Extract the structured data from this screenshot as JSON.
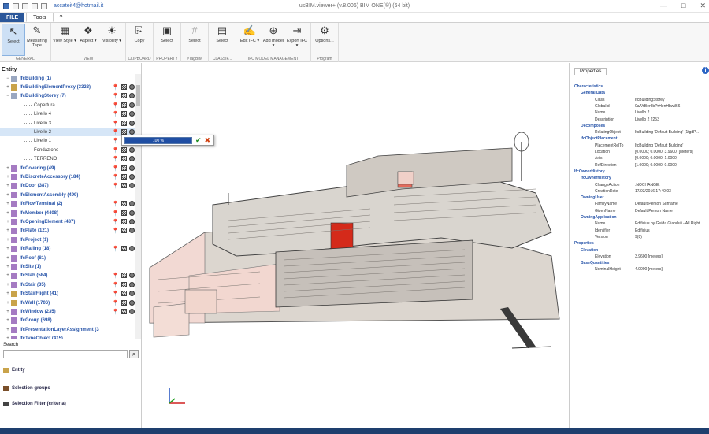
{
  "window": {
    "user": "accateit4@hotmail.it",
    "title": "usBIM.viewer+ (v.8.006) BIM ONE(®) (64 bit)",
    "controls": [
      "—",
      "□",
      "✕"
    ]
  },
  "tabs": [
    "FILE",
    "Tools",
    "?"
  ],
  "ribbon": {
    "groups": [
      {
        "label": "GENERAL",
        "buttons": [
          {
            "label": "Select",
            "icon": "cursor-icon",
            "glyph": "↖",
            "selected": true
          },
          {
            "label": "Measuring Tape",
            "icon": "measuring-tape-icon",
            "glyph": "✎"
          }
        ]
      },
      {
        "label": "VIEW",
        "buttons": [
          {
            "label": "View Style ▾",
            "icon": "view-style-icon",
            "glyph": "▦"
          },
          {
            "label": "Aspect ▾",
            "icon": "aspect-icon",
            "glyph": "❖"
          },
          {
            "label": "Visibility ▾",
            "icon": "lightbulb-icon",
            "glyph": "☀"
          }
        ]
      },
      {
        "label": "CLIPBOARD",
        "buttons": [
          {
            "label": "Copy",
            "icon": "copy-icon",
            "glyph": "⎘"
          }
        ]
      },
      {
        "label": "PROPERTY",
        "buttons": [
          {
            "label": "Select",
            "icon": "select-property-icon",
            "glyph": "▣"
          }
        ]
      },
      {
        "label": "#TagBIM",
        "buttons": [
          {
            "label": "Select",
            "icon": "tag-bim-icon",
            "glyph": "#",
            "disabled": true
          }
        ]
      },
      {
        "label": "CLASSIF...",
        "buttons": [
          {
            "label": "Select",
            "icon": "classification-icon",
            "glyph": "▤"
          }
        ]
      },
      {
        "label": "IFC MODEL MANAGEMENT",
        "buttons": [
          {
            "label": "Edit IFC ▾",
            "icon": "edit-ifc-icon",
            "glyph": "✍"
          },
          {
            "label": "Add model ▾",
            "icon": "add-model-icon",
            "glyph": "⊕"
          },
          {
            "label": "Export IFC ▾",
            "icon": "export-ifc-icon",
            "glyph": "⇥"
          }
        ]
      },
      {
        "label": "Program",
        "buttons": [
          {
            "label": "Options...",
            "icon": "options-icon",
            "glyph": "⚙"
          }
        ]
      }
    ]
  },
  "entity_panel": {
    "header": "Entity",
    "tree": [
      {
        "label": "IfcBuilding (1)",
        "level": 1,
        "expander": "−",
        "icon_color": "#9aa7c0",
        "actions": false
      },
      {
        "label": "IfcBuildingElementProxy (3323)",
        "level": 1,
        "expander": "+",
        "icon_color": "#c9a34a",
        "actions": true
      },
      {
        "label": "IfcBuildingStorey (7)",
        "level": 1,
        "expander": "−",
        "icon_color": "#9aa7c0",
        "actions": true
      },
      {
        "label": "Copertura",
        "level": 2,
        "actions": true
      },
      {
        "label": "Livello 4",
        "level": 2,
        "actions": true
      },
      {
        "label": "Livello 3",
        "level": 2,
        "actions": true
      },
      {
        "label": "Livello 2",
        "level": 2,
        "selected": true,
        "actions": true
      },
      {
        "label": "Livello 1",
        "level": 2,
        "actions": true
      },
      {
        "label": "Fondazione",
        "level": 2,
        "actions": true
      },
      {
        "label": "TERRENO",
        "level": 2,
        "actions": true
      },
      {
        "label": "IfcCovering (49)",
        "level": 1,
        "expander": "+",
        "icon_color": "#a57bc2",
        "actions": true
      },
      {
        "label": "IfcDiscreteAccessory (184)",
        "level": 1,
        "expander": "+",
        "icon_color": "#a57bc2",
        "actions": true
      },
      {
        "label": "IfcDoor (387)",
        "level": 1,
        "expander": "+",
        "icon_color": "#a57bc2",
        "actions": true
      },
      {
        "label": "IfcElementAssembly (499)",
        "level": 1,
        "expander": "+",
        "icon_color": "#a57bc2",
        "actions": false
      },
      {
        "label": "IfcFlowTerminal (2)",
        "level": 1,
        "expander": "+",
        "icon_color": "#a57bc2",
        "actions": true
      },
      {
        "label": "IfcMember (4408)",
        "level": 1,
        "expander": "+",
        "icon_color": "#a57bc2",
        "actions": true
      },
      {
        "label": "IfcOpeningElement (487)",
        "level": 1,
        "expander": "+",
        "icon_color": "#a57bc2",
        "actions": true
      },
      {
        "label": "IfcPlate (121)",
        "level": 1,
        "expander": "+",
        "icon_color": "#a57bc2",
        "actions": true
      },
      {
        "label": "IfcProject (1)",
        "level": 1,
        "expander": "+",
        "icon_color": "#a57bc2",
        "actions": false
      },
      {
        "label": "IfcRailing (18)",
        "level": 1,
        "expander": "+",
        "icon_color": "#a57bc2",
        "actions": true
      },
      {
        "label": "IfcRoof (81)",
        "level": 1,
        "expander": "+",
        "icon_color": "#a57bc2",
        "actions": false
      },
      {
        "label": "IfcSite (1)",
        "level": 1,
        "expander": "+",
        "icon_color": "#a57bc2",
        "actions": false
      },
      {
        "label": "IfcSlab (584)",
        "level": 1,
        "expander": "+",
        "icon_color": "#a57bc2",
        "actions": true
      },
      {
        "label": "IfcStair (35)",
        "level": 1,
        "expander": "+",
        "icon_color": "#a57bc2",
        "actions": true
      },
      {
        "label": "IfcStairFlight (41)",
        "level": 1,
        "expander": "+",
        "icon_color": "#c9a34a",
        "actions": true
      },
      {
        "label": "IfcWall (1706)",
        "level": 1,
        "expander": "+",
        "icon_color": "#c9a34a",
        "actions": true
      },
      {
        "label": "IfcWindow (235)",
        "level": 1,
        "expander": "+",
        "icon_color": "#a57bc2",
        "actions": true
      },
      {
        "label": "IfcGroup (698)",
        "level": 1,
        "expander": "+",
        "icon_color": "#a57bc2",
        "actions": false
      },
      {
        "label": "IfcPresentationLayerAssignment (3",
        "level": 1,
        "expander": "+",
        "icon_color": "#a57bc2",
        "actions": false
      },
      {
        "label": "IfcTypeObject (415)",
        "level": 1,
        "expander": "+",
        "icon_color": "#a57bc2",
        "actions": false
      }
    ],
    "search_label": "Search",
    "search_value": "",
    "sections": [
      "Entity",
      "Selection groups",
      "Selection Filter (criteria)"
    ]
  },
  "progress": {
    "text": "100 %",
    "value": 1.0
  },
  "properties_panel": {
    "tab": "Properties",
    "rows": [
      {
        "k": "Characteristics",
        "v": "",
        "level": 0,
        "section": true
      },
      {
        "k": "General Data",
        "v": "",
        "level": 1,
        "section": true
      },
      {
        "k": "Class",
        "v": "IfcBuildingStorey",
        "level": 2
      },
      {
        "k": "GlobalId",
        "v": "0aAYBerfIbPrHenHbwtl66",
        "level": 2
      },
      {
        "k": "Name",
        "v": "Livello 2",
        "level": 2
      },
      {
        "k": "Description",
        "v": "Livello 2 2253",
        "level": 2
      },
      {
        "k": "Decomposes",
        "v": "",
        "level": 1,
        "section": true
      },
      {
        "k": "RelatingObject",
        "v": "IfcBuilding 'Default Building' (1tgdP...",
        "level": 2
      },
      {
        "k": "IfcObjectPlacement",
        "v": "",
        "level": 1,
        "section": true
      },
      {
        "k": "PlacementRelTo",
        "v": "IfcBuilding 'Default Building'",
        "level": 2
      },
      {
        "k": "Location",
        "v": "[0.0000; 0.0000; 3.9600] [Meters]",
        "level": 2
      },
      {
        "k": "Axis",
        "v": "[0.0000; 0.0000; 1.0000]",
        "level": 2
      },
      {
        "k": "RefDirection",
        "v": "[1.0000; 0.0000; 0.0000]",
        "level": 2
      },
      {
        "k": "IfcOwnerHistory",
        "v": "",
        "level": 0,
        "section": true
      },
      {
        "k": "IfcOwnerHistory",
        "v": "",
        "level": 1,
        "section": true
      },
      {
        "k": "ChangeAction",
        "v": ".NOCHANGE.",
        "level": 2
      },
      {
        "k": "CreationDate",
        "v": "17/03/2016 17:40:03",
        "level": 2
      },
      {
        "k": "OwningUser",
        "v": "",
        "level": 1,
        "section": true
      },
      {
        "k": "FamilyName",
        "v": "Default Person Surname",
        "level": 2
      },
      {
        "k": "GivenName",
        "v": "Default Person Name",
        "level": 2
      },
      {
        "k": "OwningApplication",
        "v": "",
        "level": 1,
        "section": true
      },
      {
        "k": "Name",
        "v": "Edificius by Guida Gianduli - All Right",
        "level": 2
      },
      {
        "k": "Identifier",
        "v": "Edificius",
        "level": 2
      },
      {
        "k": "Version",
        "v": "9(8)",
        "level": 2
      },
      {
        "k": "Properties",
        "v": "",
        "level": 0,
        "section": true
      },
      {
        "k": "Elevation",
        "v": "",
        "level": 1,
        "section": true
      },
      {
        "k": "Elevation",
        "v": "3.9600 [meters]",
        "level": 2
      },
      {
        "k": "BaseQuantities",
        "v": "",
        "level": 1,
        "section": true
      },
      {
        "k": "NominalHeight",
        "v": "4.0000 [meters]",
        "level": 2
      }
    ]
  },
  "colors": {
    "accent": "#2b579a",
    "status_bar": "#1e3f6e",
    "tree_label": "#2653a8"
  }
}
